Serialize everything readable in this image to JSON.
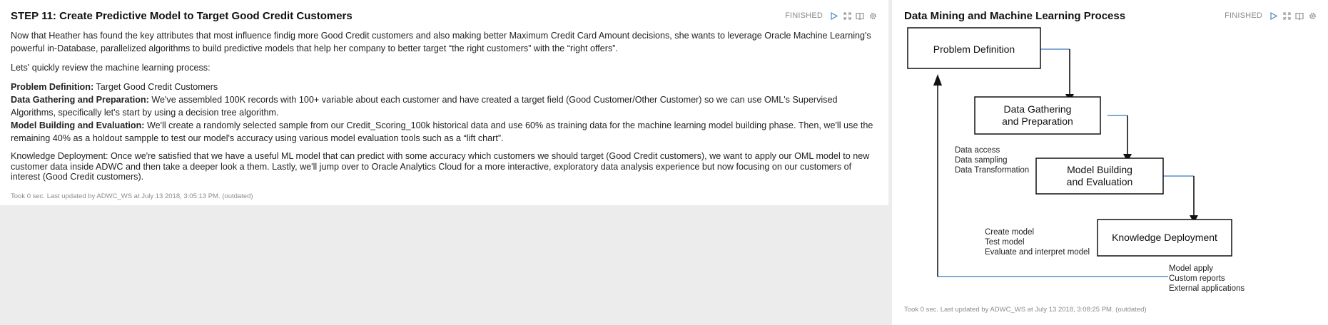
{
  "left": {
    "title": "STEP 11: Create Predictive Model to Target Good Credit Customers",
    "status": "FINISHED",
    "intro": "Now that Heather has found the key attributes that most influence findig more Good Credit customers and also making better Maximum Credit Card Amount decisions, she wants to leverage Oracle Machine Learning's powerful in-Database, parallelized algorithms to build predictive models that help her company to better target “the right customers” with the “right offers”.",
    "review": "Lets' quickly review the machine learning process:",
    "problem_label": "Problem Definition:",
    "problem_text": " Target Good Credit Customers",
    "data_label": "Data Gathering and Preparation:",
    "data_text": " We've assembled 100K records with 100+ variable about each customer and have created a target field (Good Customer/Other Customer) so we can use OML's Supervised Algorithms, specifically let's start by using a decision tree algorithm.",
    "model_label": "Model Building and Evaluation:",
    "model_text": " We'll create a randomly selected sample from our Credit_Scoring_100k historical data and use 60% as training data for the machine learning model building phase. Then, we'll use the remaining 40% as a holdout sampple to test our model's accuracy using various model evaluation tools such as a “lift chart”.",
    "deploy_text": "Knowledge Deployment: Once we're satisfied that we have a useful ML model that can predict with some accuracy which customers we should target (Good Credit customers), we want to apply our OML model to new customer data inside ADWC and then take a deeper look a them. Lastly, we'll jump over to Oracle Analytics Cloud for a more interactive, exploratory data analysis experience but now focusing on our customers of interest (Good Credit customers).",
    "footer": "Took 0 sec. Last updated by ADWC_WS at July 13 2018, 3:05:13 PM. (outdated)"
  },
  "right": {
    "title": "Data Mining and Machine Learning Process",
    "status": "FINISHED",
    "footer": "Took 0 sec. Last updated by ADWC_WS at July 13 2018, 3:08:25 PM. (outdated)",
    "diagram": {
      "box1": "Problem Definition",
      "box2_line1": "Data Gathering",
      "box2_line2": "and Preparation",
      "box3_line1": "Model Building",
      "box3_line2": "and Evaluation",
      "box4": "Knowledge Deployment",
      "note1": [
        "Data access",
        "Data sampling",
        "Data Transformation"
      ],
      "note2": [
        "Create model",
        "Test model",
        "Evaluate and interpret model"
      ],
      "note3": [
        "Model apply",
        "Custom reports",
        "External applications"
      ]
    }
  },
  "icons": [
    "play-icon",
    "expand-icon",
    "book-icon",
    "gear-icon"
  ],
  "colors": {
    "connector_blue": "#5b8ec9",
    "arrow_black": "#111111"
  }
}
